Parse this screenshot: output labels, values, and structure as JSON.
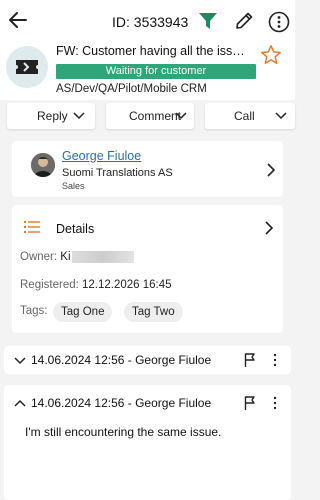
{
  "topbar": {
    "ticket_id": "ID: 3533943"
  },
  "ticket": {
    "title": "FW: Customer having all the issues ...",
    "status": "Waiting for customer",
    "category_path": "AS/Dev/QA/Pilot/Mobile CRM"
  },
  "actions": {
    "reply": "Reply",
    "comment": "Comment",
    "call": "Call"
  },
  "contact": {
    "name": "George Fiuloe",
    "company": "Suomi Translations AS",
    "role": "Sales"
  },
  "details": {
    "label": "Details",
    "owner_label": "Owner:",
    "owner_value": "Ki",
    "registered_label": "Registered:",
    "registered_value": "12.12.2026 16:45",
    "tags_label": "Tags:",
    "tags": [
      "Tag One",
      "Tag Two"
    ]
  },
  "messages": [
    {
      "title": "14.06.2024 12:56 - George Fiuloe",
      "expanded": false,
      "body": ""
    },
    {
      "title": "14.06.2024 12:56 - George Fiuloe",
      "expanded": true,
      "body": "I'm still encountering the same issue."
    }
  ],
  "colors": {
    "accent": "#2fa57a",
    "filter": "#1f8a5e",
    "star": "#e8782a",
    "list_icon": "#e8782a",
    "link": "#2a6fa8"
  },
  "icons": [
    "back-arrow-icon",
    "filter-icon",
    "edit-icon",
    "more-icon",
    "ticket-icon",
    "star-icon",
    "chevron-down-icon",
    "chevron-right-icon",
    "list-icon",
    "chevron-up-icon",
    "flag-icon",
    "kebab-icon"
  ]
}
